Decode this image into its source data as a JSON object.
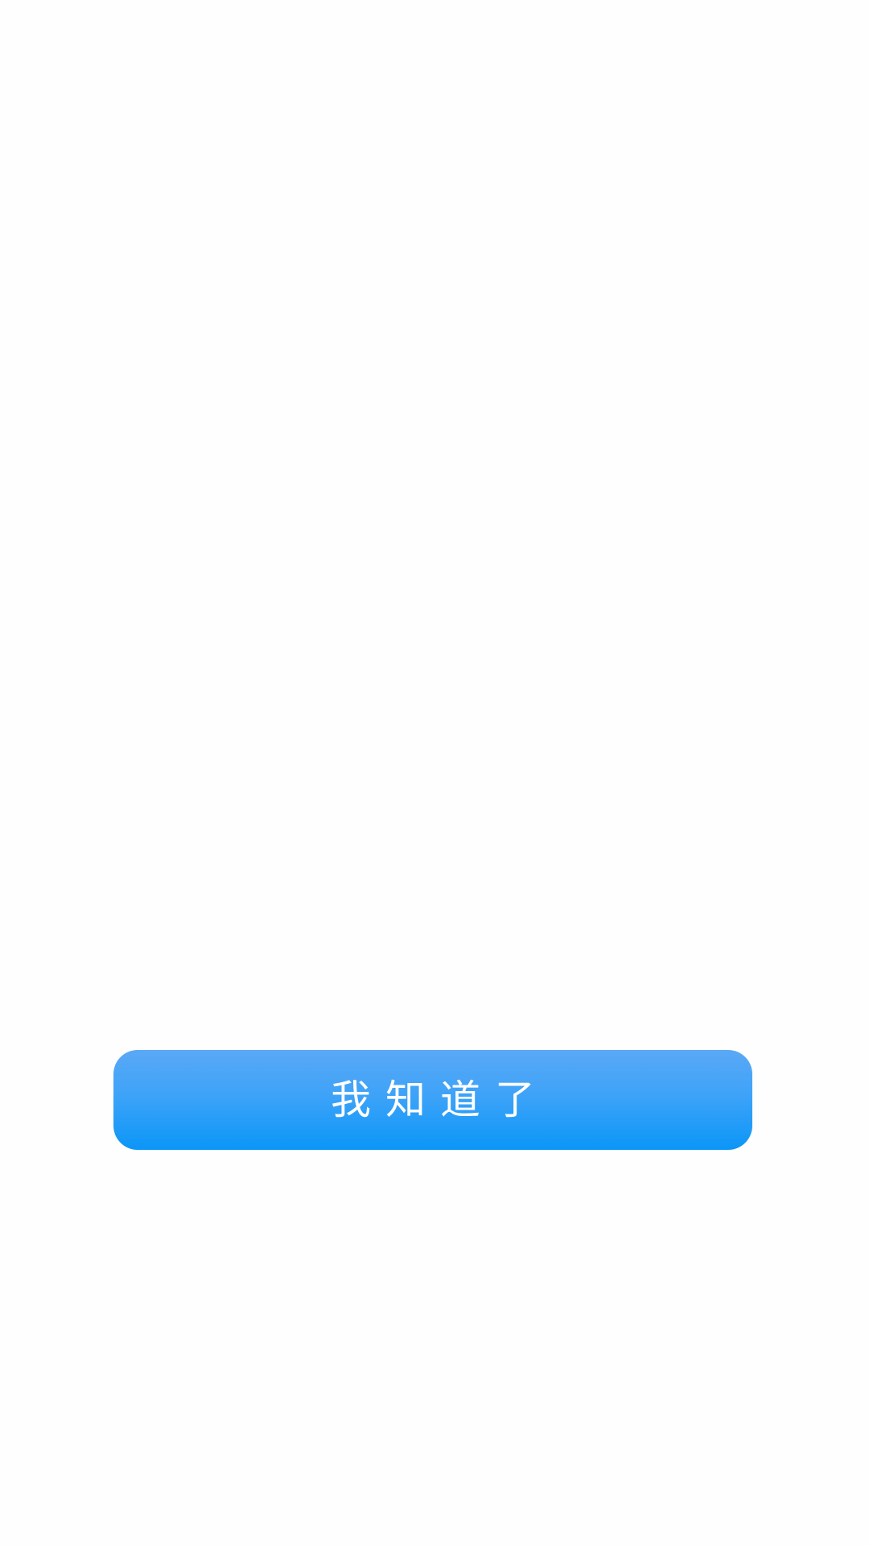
{
  "dialog": {
    "confirm_button_label": "我知道了"
  },
  "colors": {
    "background": "#fefefe",
    "button_gradient_top": "#5aa8f6",
    "button_gradient_bottom": "#0b96f7",
    "button_text": "#ffffff"
  }
}
